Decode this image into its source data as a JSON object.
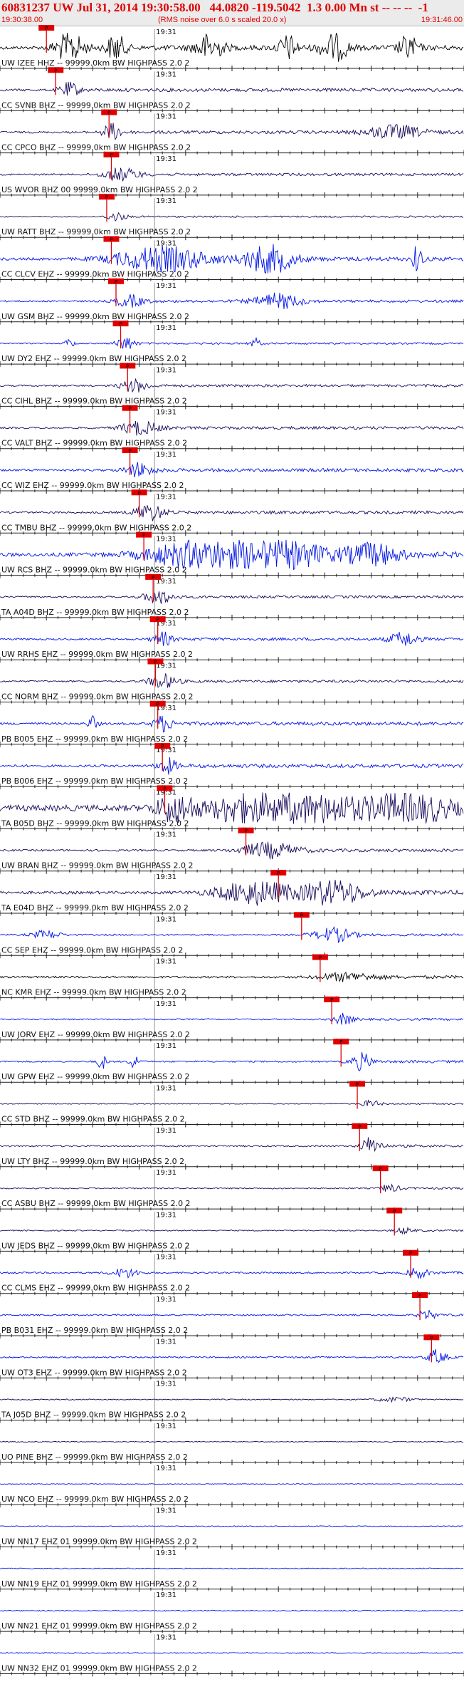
{
  "header": {
    "title": "60831237 UW Jul 31, 2014 19:30:58.00   44.0820 -119.5042  1.3 0.00 Mn st -- -- --  -1",
    "start_time": "19:30:38.00",
    "note": "(RMS noise over 6.0 s scaled 20.0 x)",
    "end_time": "19:31:46.00"
  },
  "minute_label": "19:31",
  "pick_label": "P",
  "colors": {
    "dark": "#1a0a5c",
    "blue": "#0014e6",
    "black": "#000000",
    "pick": "#e00000"
  },
  "traces": [
    {
      "label": "UW IZEE HHZ -- 99999.0km BW  HIGHPASS  2.0  2",
      "color": "black",
      "pick": 0.1,
      "amp": 0.95,
      "base": 0.3,
      "bursts": [
        [
          0.15,
          0.03,
          1.0
        ],
        [
          0.25,
          0.02,
          0.9
        ],
        [
          0.45,
          0.03,
          0.9
        ],
        [
          0.62,
          0.02,
          0.8
        ],
        [
          0.72,
          0.03,
          0.9
        ],
        [
          0.88,
          0.02,
          0.8
        ]
      ]
    },
    {
      "label": "CC SVNB BHZ -- 99999.0km BW  HIGHPASS  2.0  2",
      "color": "dark",
      "pick": 0.12,
      "amp": 0.55,
      "base": 0.35,
      "bursts": [
        [
          0.15,
          0.02,
          0.8
        ]
      ]
    },
    {
      "label": "CC CPCO BHZ -- 99999.0km BW  HIGHPASS  2.0  2",
      "color": "dark",
      "pick": 0.235,
      "amp": 0.6,
      "base": 0.3,
      "bursts": [
        [
          0.24,
          0.02,
          0.9
        ],
        [
          0.85,
          0.06,
          0.7
        ]
      ]
    },
    {
      "label": "US WVOR BHZ 00 99999.0km BW  HIGHPASS  2.0  2",
      "color": "dark",
      "pick": 0.24,
      "amp": 0.5,
      "base": 0.3,
      "bursts": [
        [
          0.26,
          0.04,
          0.8
        ]
      ]
    },
    {
      "label": "UW RATT BHZ -- 99999.0km BW  HIGHPASS  2.0  2",
      "color": "dark",
      "pick": 0.23,
      "amp": 0.4,
      "base": 0.25,
      "bursts": [
        [
          0.25,
          0.02,
          0.7
        ]
      ]
    },
    {
      "label": "CC CLCV EHZ -- 99999.0km BW  HIGHPASS  2.0  2",
      "color": "blue",
      "pick": 0.24,
      "amp": 0.95,
      "base": 0.25,
      "bursts": [
        [
          0.35,
          0.1,
          0.8
        ],
        [
          0.58,
          0.05,
          1.0
        ],
        [
          0.9,
          0.01,
          1.0
        ]
      ]
    },
    {
      "label": "UW GSM BHZ -- 99999.0km BW  HIGHPASS  2.0  2",
      "color": "blue",
      "pick": 0.25,
      "amp": 0.6,
      "base": 0.25,
      "bursts": [
        [
          0.6,
          0.05,
          0.8
        ],
        [
          0.28,
          0.03,
          0.6
        ]
      ]
    },
    {
      "label": "UW DY2 EHZ -- 99999.0km BW  HIGHPASS  2.0  2",
      "color": "blue",
      "pick": 0.26,
      "amp": 0.55,
      "base": 0.2,
      "bursts": [
        [
          0.27,
          0.02,
          0.8
        ],
        [
          0.15,
          0.01,
          0.6
        ],
        [
          0.55,
          0.01,
          0.6
        ]
      ]
    },
    {
      "label": "CC CIHL BHZ -- 99999.0km BW  HIGHPASS  2.0  2",
      "color": "dark",
      "pick": 0.275,
      "amp": 0.5,
      "base": 0.3,
      "bursts": [
        [
          0.29,
          0.03,
          0.8
        ]
      ]
    },
    {
      "label": "CC VALT BHZ -- 99999.0km BW  HIGHPASS  2.0  2",
      "color": "dark",
      "pick": 0.28,
      "amp": 0.55,
      "base": 0.3,
      "bursts": [
        [
          0.3,
          0.04,
          0.8
        ]
      ]
    },
    {
      "label": "CC WIZ EHZ -- 99999.0km BW  HIGHPASS  2.0  2",
      "color": "blue",
      "pick": 0.28,
      "amp": 0.55,
      "base": 0.35,
      "bursts": [
        [
          0.3,
          0.03,
          0.8
        ]
      ]
    },
    {
      "label": "CC TMBU BHZ -- 99999.0km BW  HIGHPASS  2.0  2",
      "color": "dark",
      "pick": 0.3,
      "amp": 0.6,
      "base": 0.3,
      "bursts": [
        [
          0.32,
          0.03,
          1.0
        ]
      ]
    },
    {
      "label": "UW RCS BHZ -- 99999.0km BW  HIGHPASS  2.0  2",
      "color": "blue",
      "pick": 0.31,
      "amp": 0.95,
      "base": 0.35,
      "bursts": [
        [
          0.45,
          0.12,
          1.0
        ],
        [
          0.62,
          0.08,
          0.9
        ],
        [
          0.8,
          0.06,
          0.7
        ]
      ]
    },
    {
      "label": "TA A04D BHZ -- 99999.0km BW  HIGHPASS  2.0  2",
      "color": "dark",
      "pick": 0.33,
      "amp": 0.5,
      "base": 0.3,
      "bursts": [
        [
          0.34,
          0.03,
          0.9
        ]
      ]
    },
    {
      "label": "UW RRHS EHZ -- 99999.0km BW  HIGHPASS  2.0  2",
      "color": "blue",
      "pick": 0.34,
      "amp": 0.55,
      "base": 0.3,
      "bursts": [
        [
          0.35,
          0.02,
          0.8
        ],
        [
          0.87,
          0.03,
          0.8
        ]
      ]
    },
    {
      "label": "CC NORM BHZ -- 99999.0km BW  HIGHPASS  2.0  2",
      "color": "dark",
      "pick": 0.335,
      "amp": 0.5,
      "base": 0.3,
      "bursts": [
        [
          0.35,
          0.03,
          0.9
        ]
      ]
    },
    {
      "label": "PB B005 EHZ -- 99999.0km BW  HIGHPASS  2.0  2",
      "color": "blue",
      "pick": 0.34,
      "amp": 0.6,
      "base": 0.35,
      "bursts": [
        [
          0.2,
          0.01,
          0.8
        ],
        [
          0.35,
          0.02,
          0.8
        ]
      ]
    },
    {
      "label": "PB B006 EHZ -- 99999.0km BW  HIGHPASS  2.0  2",
      "color": "blue",
      "pick": 0.35,
      "amp": 0.6,
      "base": 0.35,
      "bursts": [
        [
          0.36,
          0.02,
          0.8
        ]
      ]
    },
    {
      "label": "TA B05D BHZ -- 99999.0km BW  HIGHPASS  2.0  2",
      "color": "dark",
      "pick": 0.355,
      "amp": 1.0,
      "base": 0.55,
      "bursts": [
        [
          0.38,
          0.04,
          1.0
        ],
        [
          0.65,
          0.12,
          1.0
        ],
        [
          0.88,
          0.08,
          1.0
        ],
        [
          0.52,
          0.05,
          0.9
        ]
      ]
    },
    {
      "label": "UW BRAN BHZ -- 99999.0km BW  HIGHPASS  2.0  2",
      "color": "dark",
      "pick": 0.53,
      "amp": 0.6,
      "base": 0.3,
      "bursts": [
        [
          0.58,
          0.06,
          0.8
        ]
      ]
    },
    {
      "label": "TA E04D BHZ -- 99999.0km BW  HIGHPASS  2.0  2",
      "color": "dark",
      "pick": 0.6,
      "amp": 0.85,
      "base": 0.3,
      "bursts": [
        [
          0.55,
          0.08,
          0.9
        ],
        [
          0.72,
          0.06,
          1.0
        ]
      ]
    },
    {
      "label": "CC SEP EHZ -- 99999.0km BW  HIGHPASS  2.0  2",
      "color": "blue",
      "pick": 0.65,
      "amp": 0.55,
      "base": 0.25,
      "bursts": [
        [
          0.72,
          0.04,
          0.8
        ],
        [
          0.1,
          0.03,
          0.5
        ]
      ]
    },
    {
      "label": "NC KMR EHZ -- 99999.0km BW  HIGHPASS  2.0  2",
      "color": "black",
      "pick": 0.69,
      "amp": 0.4,
      "base": 0.45,
      "bursts": [
        [
          0.75,
          0.06,
          0.6
        ]
      ]
    },
    {
      "label": "UW JORV EHZ -- 99999.0km BW  HIGHPASS  2.0  2",
      "color": "blue",
      "pick": 0.715,
      "amp": 0.5,
      "base": 0.25,
      "bursts": [
        [
          0.74,
          0.02,
          0.7
        ]
      ]
    },
    {
      "label": "UW GPW EHZ -- 99999.0km BW  HIGHPASS  2.0  2",
      "color": "blue",
      "pick": 0.735,
      "amp": 0.6,
      "base": 0.25,
      "bursts": [
        [
          0.22,
          0.01,
          0.8
        ],
        [
          0.29,
          0.01,
          0.8
        ],
        [
          0.78,
          0.02,
          0.9
        ]
      ]
    },
    {
      "label": "CC STD BHZ -- 99999.0km BW  HIGHPASS  2.0  2",
      "color": "dark",
      "pick": 0.77,
      "amp": 0.35,
      "base": 0.25,
      "bursts": [
        [
          0.8,
          0.02,
          0.6
        ]
      ]
    },
    {
      "label": "UW LTY BHZ -- 99999.0km BW  HIGHPASS  2.0  2",
      "color": "dark",
      "pick": 0.775,
      "amp": 0.6,
      "base": 0.25,
      "bursts": [
        [
          0.8,
          0.02,
          1.0
        ]
      ]
    },
    {
      "label": "CC ASBU BHZ -- 99999.0km BW  HIGHPASS  2.0  2",
      "color": "dark",
      "pick": 0.82,
      "amp": 0.4,
      "base": 0.3,
      "bursts": [
        [
          0.84,
          0.02,
          0.6
        ]
      ]
    },
    {
      "label": "UW JEDS BHZ -- 99999.0km BW  HIGHPASS  2.0  2",
      "color": "dark",
      "pick": 0.85,
      "amp": 0.35,
      "base": 0.3,
      "bursts": [
        [
          0.87,
          0.02,
          0.5
        ]
      ]
    },
    {
      "label": "CC CLMS EHZ -- 99999.0km BW  HIGHPASS  2.0  2",
      "color": "blue",
      "pick": 0.885,
      "amp": 0.5,
      "base": 0.3,
      "bursts": [
        [
          0.27,
          0.03,
          0.6
        ],
        [
          0.9,
          0.02,
          0.7
        ]
      ]
    },
    {
      "label": "PB B031 EHZ -- 99999.0km BW  HIGHPASS  2.0  2",
      "color": "blue",
      "pick": 0.905,
      "amp": 0.45,
      "base": 0.3,
      "bursts": [
        [
          0.92,
          0.02,
          0.6
        ]
      ]
    },
    {
      "label": "UW OT3 EHZ -- 99999.0km BW  HIGHPASS  2.0  2",
      "color": "blue",
      "pick": 0.93,
      "amp": 0.55,
      "base": 0.25,
      "bursts": [
        [
          0.94,
          0.02,
          0.8
        ]
      ]
    },
    {
      "label": "TA J05D BHZ -- 99999.0km BW  HIGHPASS  2.0  2",
      "color": "dark",
      "pick": null,
      "amp": 0.3,
      "base": 0.3,
      "bursts": [
        [
          0.85,
          0.04,
          0.5
        ]
      ]
    },
    {
      "label": "UO PINE BHZ -- 99999.0km BW  HIGHPASS  2.0  2",
      "color": "dark",
      "pick": null,
      "amp": 0.25,
      "base": 0.3,
      "bursts": []
    },
    {
      "label": "UW NCO EHZ -- 99999.0km BW  HIGHPASS  2.0  2",
      "color": "blue",
      "pick": null,
      "amp": 0.25,
      "base": 0.3,
      "bursts": []
    },
    {
      "label": "UW NN17 EHZ 01 99999.0km BW  HIGHPASS  2.0  2",
      "color": "blue",
      "pick": null,
      "amp": 0.25,
      "base": 0.35,
      "bursts": []
    },
    {
      "label": "UW NN19 EHZ 01 99999.0km BW  HIGHPASS  2.0  2",
      "color": "blue",
      "pick": null,
      "amp": 0.25,
      "base": 0.35,
      "bursts": []
    },
    {
      "label": "UW NN21 EHZ 01 99999.0km BW  HIGHPASS  2.0  2",
      "color": "blue",
      "pick": null,
      "amp": 0.25,
      "base": 0.4,
      "bursts": []
    },
    {
      "label": "UW NN32 EHZ 01 99999.0km BW  HIGHPASS  2.0  2",
      "color": "blue",
      "pick": null,
      "amp": 0.25,
      "base": 0.4,
      "bursts": []
    }
  ]
}
